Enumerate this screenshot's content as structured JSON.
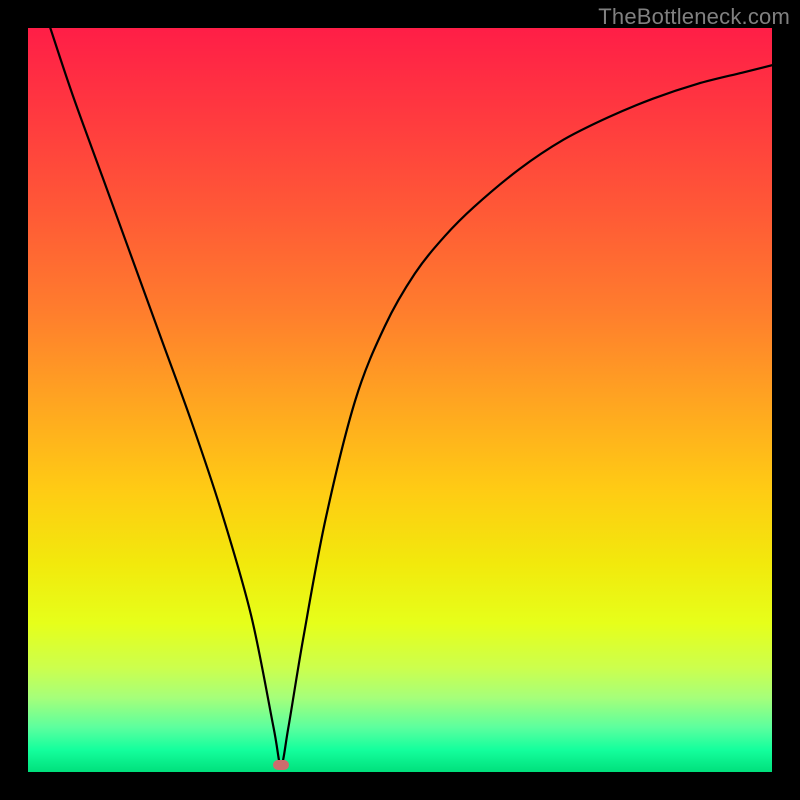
{
  "watermark": "TheBottleneck.com",
  "chart_data": {
    "type": "line",
    "title": "",
    "xlabel": "",
    "ylabel": "",
    "xlim": [
      0,
      100
    ],
    "ylim": [
      0,
      100
    ],
    "gradient_stops": [
      {
        "pos": 0,
        "color": "#ff1e47"
      },
      {
        "pos": 25,
        "color": "#ff5a36"
      },
      {
        "pos": 50,
        "color": "#ffa421"
      },
      {
        "pos": 75,
        "color": "#f2e90c"
      },
      {
        "pos": 90,
        "color": "#a6ff7a"
      },
      {
        "pos": 100,
        "color": "#00e07c"
      }
    ],
    "marker": {
      "x": 34,
      "y": 1,
      "color": "#cc6d6d"
    },
    "series": [
      {
        "name": "bottleneck-curve",
        "x": [
          3,
          6,
          10,
          14,
          18,
          22,
          26,
          30,
          33,
          34,
          35,
          37,
          40,
          44,
          48,
          52,
          56,
          60,
          66,
          72,
          78,
          84,
          90,
          96,
          100
        ],
        "y": [
          100,
          91,
          80,
          69,
          58,
          47,
          35,
          21,
          6,
          1,
          6,
          18,
          34,
          50,
          60,
          67,
          72,
          76,
          81,
          85,
          88,
          90.5,
          92.5,
          94,
          95
        ]
      }
    ]
  }
}
